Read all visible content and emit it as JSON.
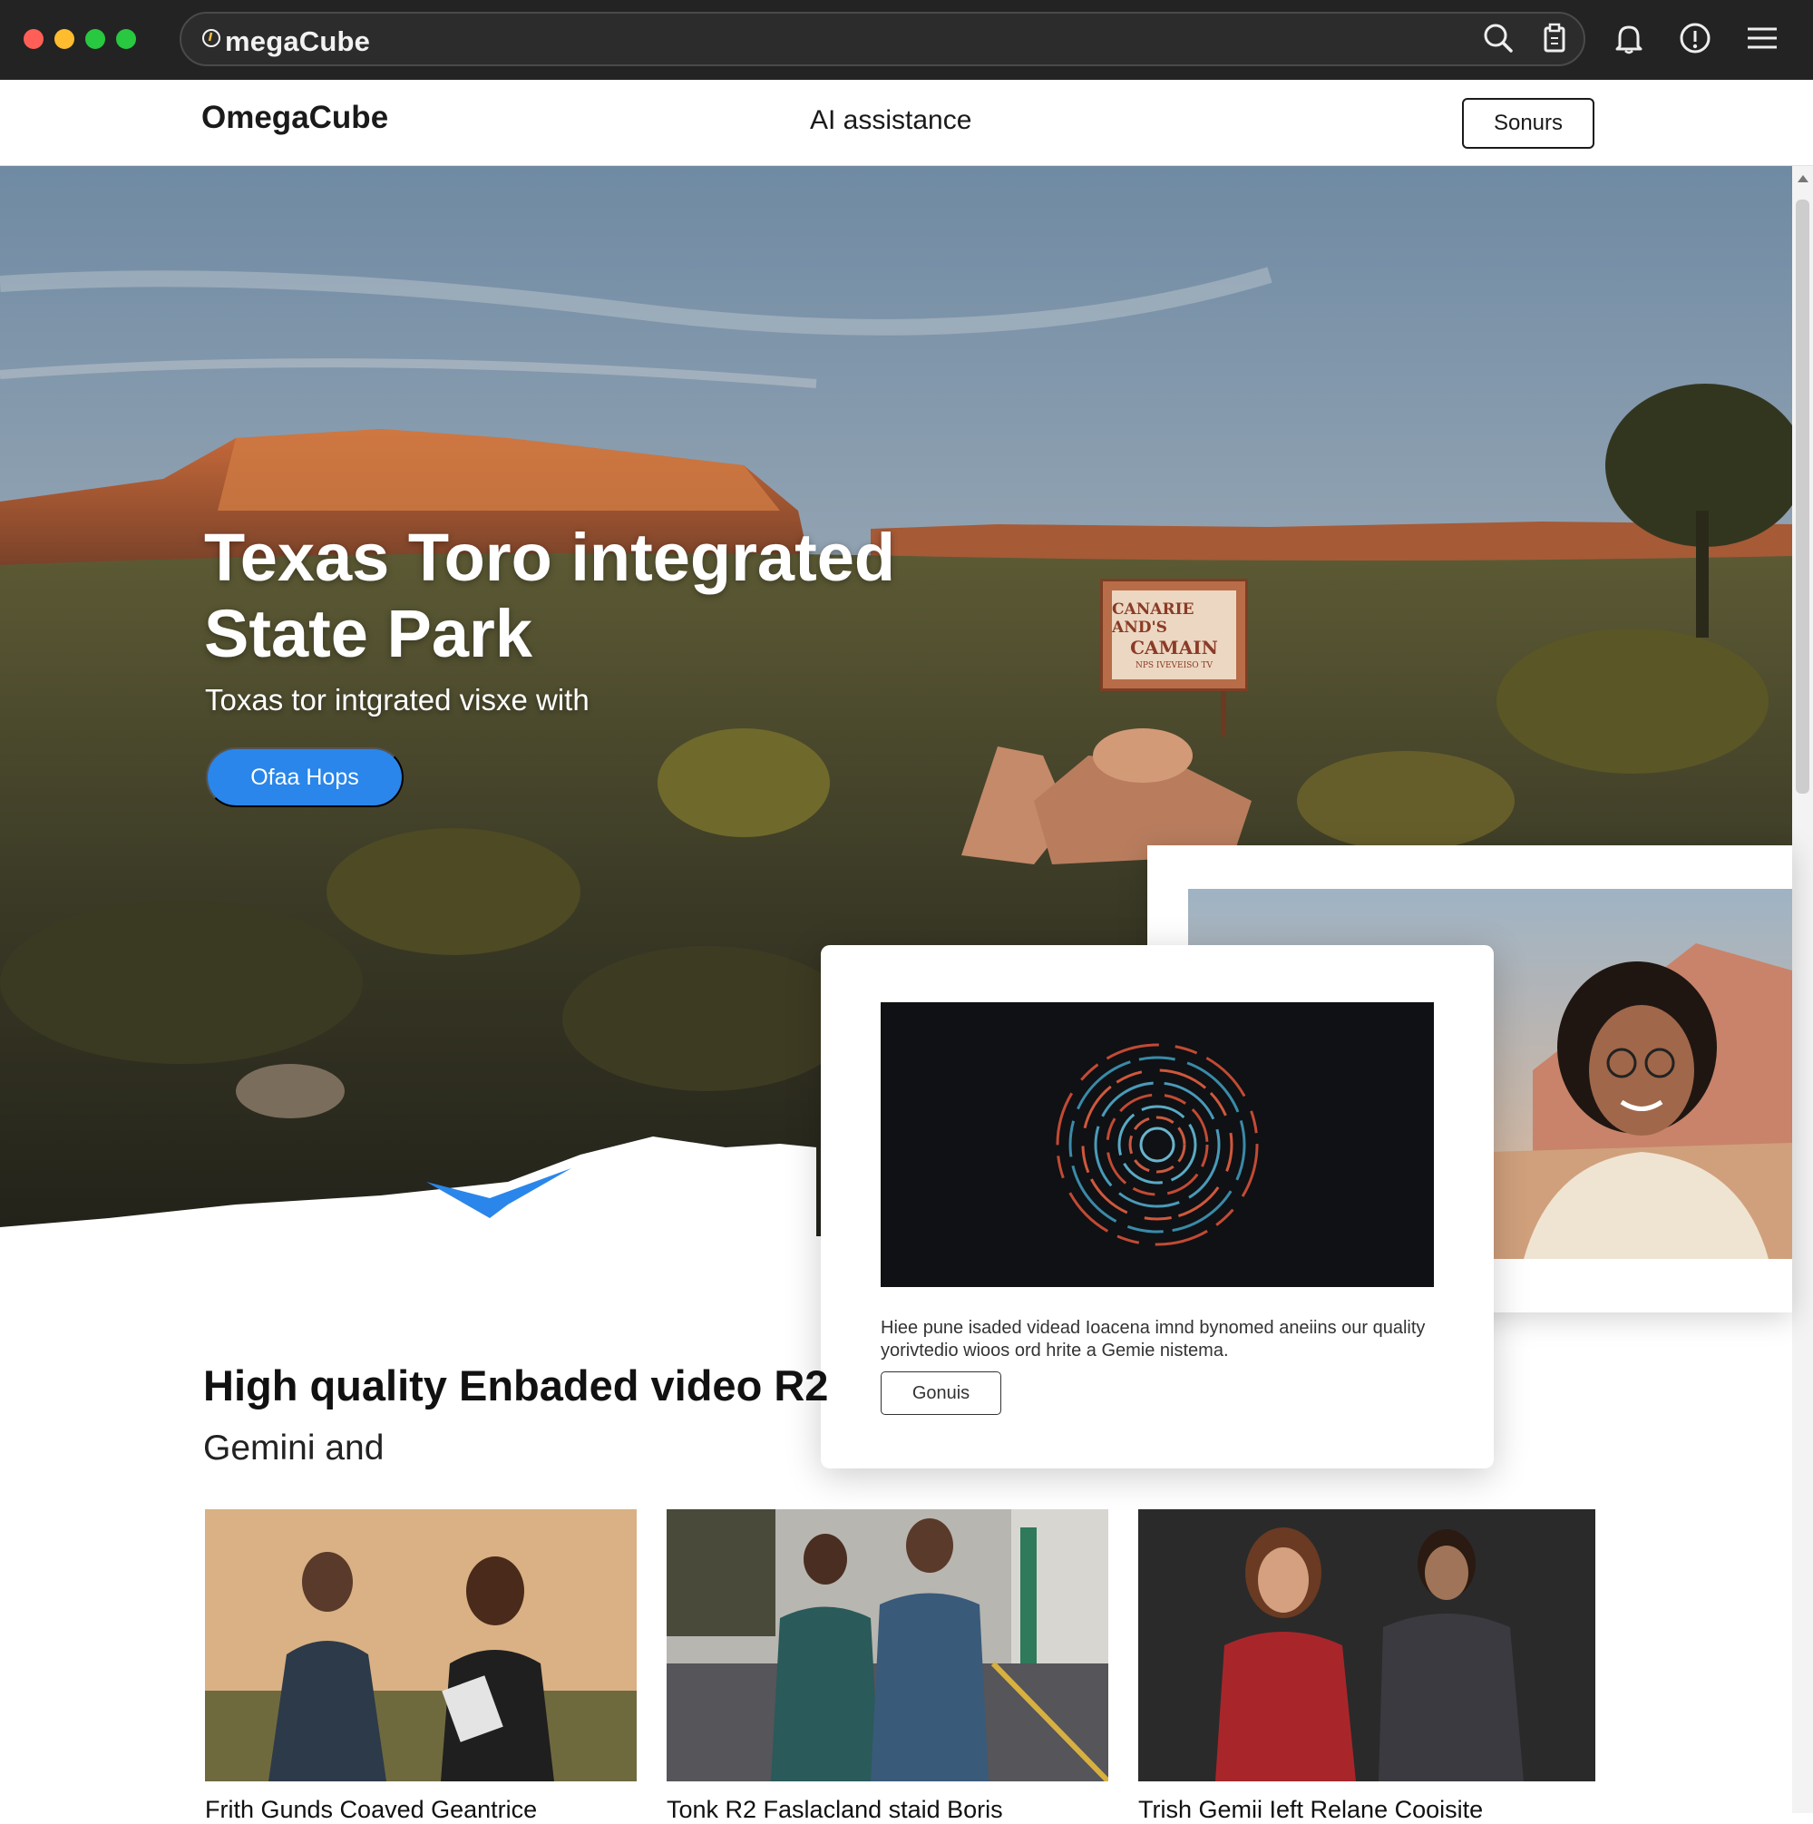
{
  "browser": {
    "window_controls": [
      {
        "name": "close",
        "color": "#ff5f57"
      },
      {
        "name": "minimize",
        "color": "#febc2e"
      },
      {
        "name": "maximize",
        "color": "#28c840"
      },
      {
        "name": "extra",
        "color": "#28c840"
      }
    ],
    "address_text": "megaCube",
    "toolbar_icons": [
      "search-icon",
      "clipboard-icon",
      "bell-icon",
      "info-icon",
      "menu-icon"
    ]
  },
  "nav": {
    "brand": "OmegaCube",
    "link": "AI assistance",
    "button": "Sonurs"
  },
  "hero": {
    "title": "Texas Toro integrated State Park",
    "subtitle": "Toxas tor intgrated visxe with",
    "cta": "Ofaa Hops",
    "sign": {
      "line1": "CANARIE AND'S",
      "line2": "CAMAIN",
      "line3": "NPS IVEVEISO TV"
    }
  },
  "video_card": {
    "description": "Hiee pune isaded videad Ioacena imnd bynomed aneiins our quality yorivtedio wioos ord hrite a Gemie nistema.",
    "button": "Gonuis"
  },
  "section": {
    "title": "High quality Enbaded video R2",
    "subtitle": "Gemini and"
  },
  "gallery": [
    {
      "caption": "Frith Gunds Coaved Geantrice"
    },
    {
      "caption": "Tonk R2 Faslacland staid Boris"
    },
    {
      "caption": "Trish Gemii Ieft Relane Cooisite"
    }
  ],
  "colors": {
    "accent": "#2a86ea",
    "chrome_bg": "#232323"
  }
}
